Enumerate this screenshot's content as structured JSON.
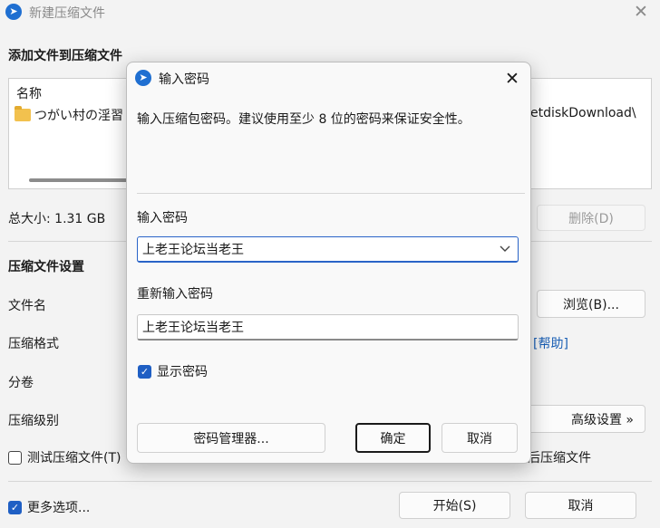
{
  "window": {
    "title": "新建压缩文件",
    "close_glyph": "✕"
  },
  "files": {
    "section_title": "添加文件到压缩文件",
    "col_name": "名称",
    "file_name": "つがい村の淫習",
    "file_path": "etdiskDownload\\"
  },
  "total_size": "总大小: 1.31 GB",
  "delete_button": "删除(D)",
  "settings": {
    "section_title": "压缩文件设置",
    "filename_label": "文件名",
    "browse_button": "浏览(B)...",
    "format_label": "压缩格式",
    "help_link": "[帮助]",
    "split_label": "分卷",
    "level_label": "压缩级别",
    "advanced_button": "高级设置 »",
    "test_checkbox": "测试压缩文件(T)",
    "test_checked": false,
    "delete_after_label": "后压缩文件"
  },
  "footer": {
    "more_options": "更多选项...",
    "more_checked": true,
    "start_button": "开始(S)",
    "cancel_button": "取消"
  },
  "dialog": {
    "title": "输入密码",
    "close_glyph": "✕",
    "description": "输入压缩包密码。建议使用至少 8 位的密码来保证安全性。",
    "password_label": "输入密码",
    "password_value": "上老王论坛当老王",
    "reenter_label": "重新输入密码",
    "reenter_value": "上老王论坛当老王",
    "show_password": "显示密码",
    "show_checked": true,
    "manager_button": "密码管理器...",
    "ok_button": "确定",
    "cancel_button": "取消"
  },
  "icons": {
    "app": "app-logo-icon",
    "folder": "folder-icon",
    "check": "✓",
    "chevron": "chevron-down-icon"
  },
  "colors": {
    "accent": "#1f5fc4",
    "link": "#1a5fb4",
    "background": "#f3f3f3"
  }
}
